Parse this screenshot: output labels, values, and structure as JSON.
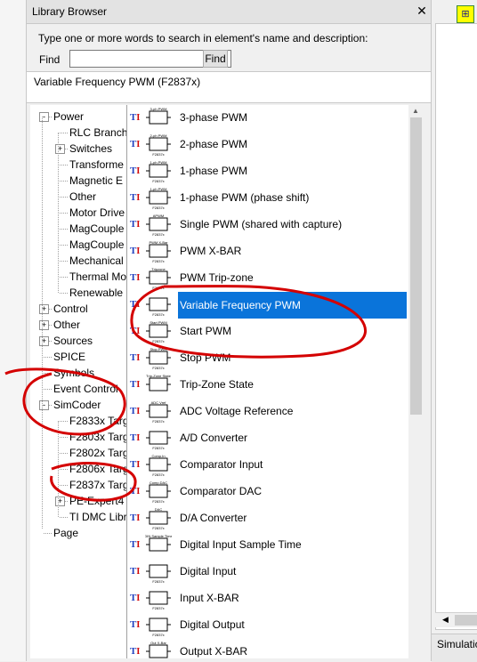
{
  "panel": {
    "title": "Library Browser",
    "close_glyph": "✕",
    "search_hint": "Type one or more words to search in element's name and  description:",
    "find_label": "Find",
    "find_value": "",
    "find_button": "Find",
    "selected_element": "Variable Frequency PWM (F2837x)"
  },
  "tree": [
    {
      "label": "Power",
      "expander": "-"
    },
    {
      "label": "RLC Branch"
    },
    {
      "label": "Switches",
      "expander": "+"
    },
    {
      "label": "Transforme"
    },
    {
      "label": "Magnetic E"
    },
    {
      "label": "Other"
    },
    {
      "label": "Motor Drive"
    },
    {
      "label": "MagCouple"
    },
    {
      "label": "MagCouple"
    },
    {
      "label": "Mechanical"
    },
    {
      "label": "Thermal Mo"
    },
    {
      "label": "Renewable"
    },
    {
      "label": "Control",
      "expander": "+"
    },
    {
      "label": "Other",
      "expander": "+"
    },
    {
      "label": "Sources",
      "expander": "+"
    },
    {
      "label": "SPICE"
    },
    {
      "label": "Symbols"
    },
    {
      "label": "Event Control"
    },
    {
      "label": "SimCoder",
      "expander": "-"
    },
    {
      "label": "F2833x Targ"
    },
    {
      "label": "F2803x Targ"
    },
    {
      "label": "F2802x Targ"
    },
    {
      "label": "F2806x Targ"
    },
    {
      "label": "F2837x Targ"
    },
    {
      "label": "PE-Expert4",
      "expander": "+"
    },
    {
      "label": "TI DMC Libr"
    },
    {
      "label": "Page"
    }
  ],
  "elements": [
    {
      "label": "3-phase PWM",
      "sym_top": "3-ph PWM",
      "sym_bot": ""
    },
    {
      "label": "2-phase PWM",
      "sym_top": "2-ph PWM",
      "sym_bot": "F2837x"
    },
    {
      "label": "1-phase PWM",
      "sym_top": "1-ph PWM",
      "sym_bot": "F2837x"
    },
    {
      "label": "1-phase PWM (phase shift)",
      "sym_top": "1-ph PWM",
      "sym_bot": "F2837x"
    },
    {
      "label": "Single PWM (shared with capture)",
      "sym_top": "APWM",
      "sym_bot": "F2837x"
    },
    {
      "label": "PWM X-BAR",
      "sym_top": "PWM X-Bar",
      "sym_bot": "F2837x"
    },
    {
      "label": "PWM Trip-zone",
      "sym_top": "Tripzone",
      "sym_bot": "F2837x"
    },
    {
      "label": "Variable Frequency PWM",
      "sym_top": "",
      "sym_bot": "F2837x"
    },
    {
      "label": "Start PWM",
      "sym_top": "Start PWM",
      "sym_bot": "F2837x"
    },
    {
      "label": "Stop PWM",
      "sym_top": "Stop PWM",
      "sym_bot": "F2837x"
    },
    {
      "label": "Trip-Zone State",
      "sym_top": "Trip-Zone State",
      "sym_bot": ""
    },
    {
      "label": "ADC Voltage Reference",
      "sym_top": "ADC Vref",
      "sym_bot": "F2837x"
    },
    {
      "label": "A/D Converter",
      "sym_top": "",
      "sym_bot": "F2837x"
    },
    {
      "label": "Comparator Input",
      "sym_top": "Comp.In",
      "sym_bot": "F2837x"
    },
    {
      "label": "Comparator DAC",
      "sym_top": "Comp.DAC",
      "sym_bot": "F2837x"
    },
    {
      "label": "D/A Converter",
      "sym_top": "DAC",
      "sym_bot": "F2837x"
    },
    {
      "label": "Digital Input Sample Time",
      "sym_top": "DIN Sample Time",
      "sym_bot": ""
    },
    {
      "label": "Digital Input",
      "sym_top": "",
      "sym_bot": "F2837x"
    },
    {
      "label": "Input X-BAR",
      "sym_top": "",
      "sym_bot": "F2837x"
    },
    {
      "label": "Digital Output",
      "sym_top": "",
      "sym_bot": "F2837x"
    },
    {
      "label": "Output X-BAR",
      "sym_top": "Out X-Bar",
      "sym_bot": ""
    }
  ],
  "right_panel": {
    "sim_tab": "Simulatio",
    "scroll_left": "◀"
  },
  "colors": {
    "selection": "#0a74da",
    "annotation": "#d40000"
  }
}
